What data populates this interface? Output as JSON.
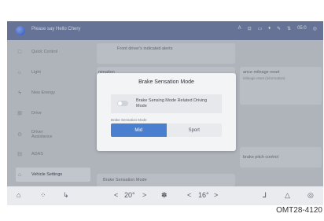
{
  "topbar": {
    "assistant_text": "Please say Hello Chery",
    "status_items": [
      "A",
      "⊡",
      "▭",
      "⬧",
      "✎",
      "⇅",
      "05:0",
      "◎"
    ]
  },
  "sidebar": {
    "items": [
      {
        "label": "Quick Control",
        "icon": "□"
      },
      {
        "label": "Light",
        "icon": "☼"
      },
      {
        "label": "New Energy",
        "icon": "ϟ"
      },
      {
        "label": "Drive",
        "icon": "⊞"
      },
      {
        "label": "Driver Assistance",
        "icon": "⊙"
      },
      {
        "label": "ADAS",
        "icon": "⊟"
      },
      {
        "label": "Vehicle Settings",
        "icon": "⌂"
      }
    ]
  },
  "main": {
    "card1_text": "Front driver's indicated alerts",
    "card2_text": "nimation",
    "card3_text": "ance mileage reset",
    "card3_sub": "Mileage reset (information)",
    "card4_text": "brake pitch control",
    "card5_text": "Brake Sensation Mode"
  },
  "dialog": {
    "title": "Brake Sensation Mode",
    "option_label": "Brake Sensing Mode Related Driving Mode",
    "toggle_on": false,
    "section_label": "Brake Sensation Mode",
    "segments": [
      {
        "label": "Mid",
        "selected": true
      },
      {
        "label": "Sport",
        "selected": false
      }
    ]
  },
  "bottombar": {
    "home": "⌂",
    "apps": "⁘",
    "seat": "↳",
    "left_temp_down": "<",
    "left_temp": "20°",
    "left_temp_up": ">",
    "fan": "✽",
    "right_temp_down": "<",
    "right_temp": "16°",
    "right_temp_up": ">",
    "seat_heat": "⅃",
    "warning": "△",
    "power": "◎"
  },
  "caption": "OMT28-4120"
}
